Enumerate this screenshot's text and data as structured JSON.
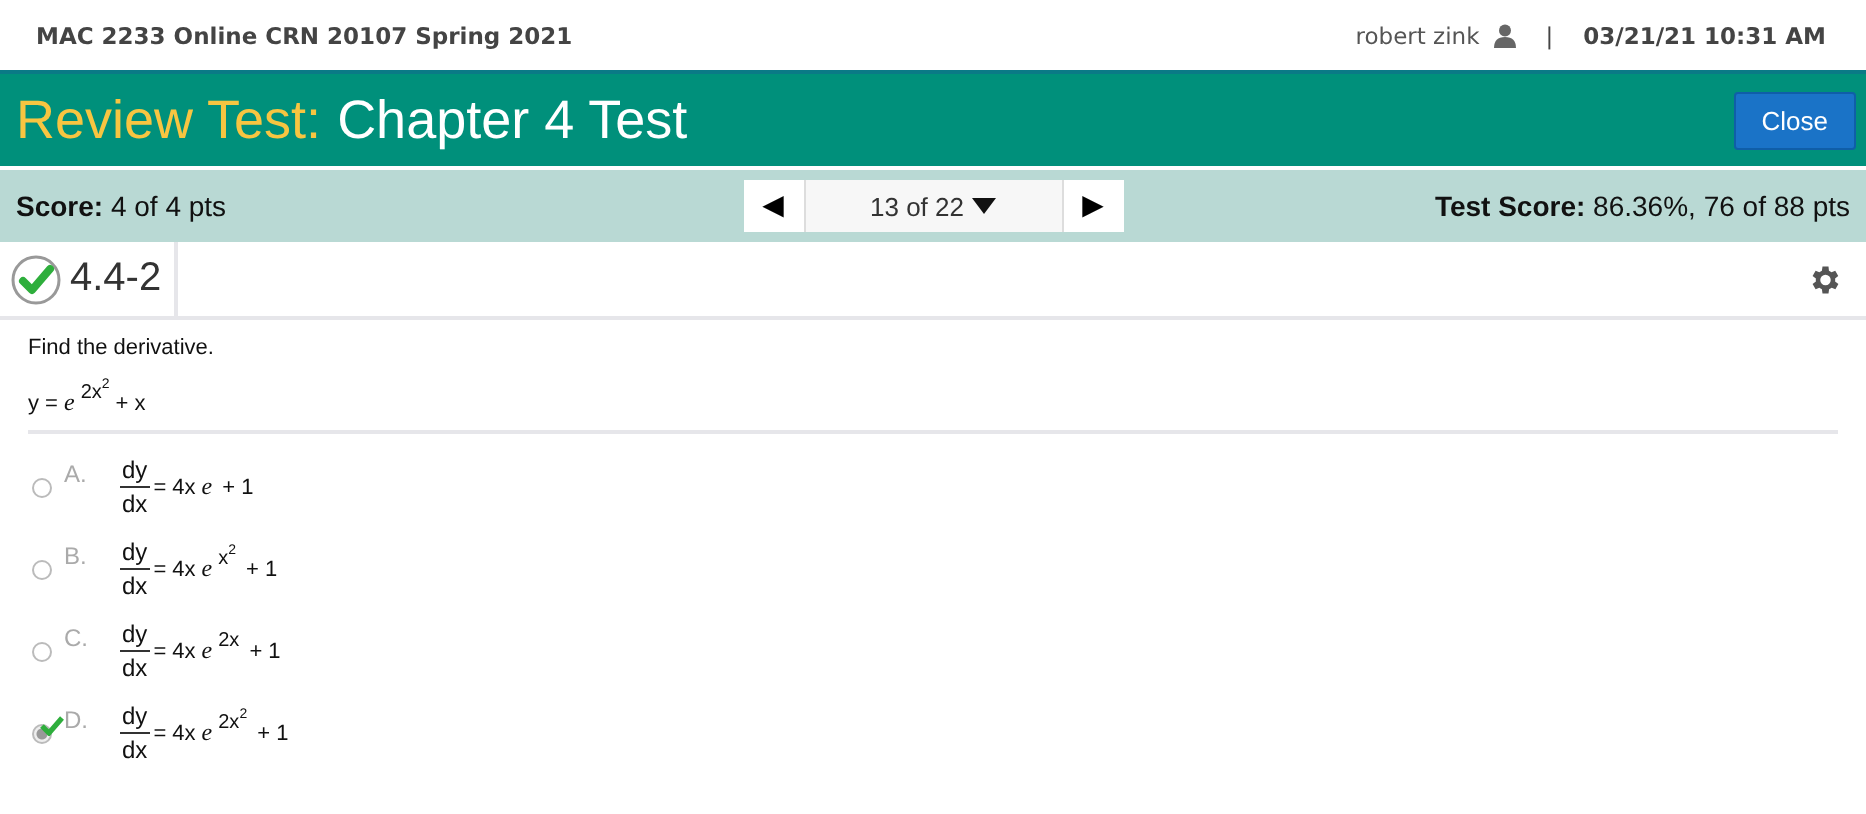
{
  "top_bar": {
    "course": "MAC 2233 Online CRN 20107 Spring 2021",
    "user": "robert zink",
    "separator": "|",
    "datetime": "03/21/21 10:31 AM"
  },
  "header": {
    "prefix": "Review Test:",
    "title": "Chapter 4 Test",
    "close_button": "Close"
  },
  "score_bar": {
    "score_label": "Score:",
    "score_value": "4 of 4 pts",
    "prev": "◀",
    "position": "13 of 22",
    "next": "▶",
    "test_score_label": "Test Score:",
    "test_score_value": "86.36%, 76 of 88 pts"
  },
  "question": {
    "id": "4.4-2",
    "correct": true,
    "prompt": "Find the derivative.",
    "equation": {
      "lhs": "y =",
      "base": "e",
      "exponent": "2x",
      "exponent_power": "2",
      "tail": "+ x"
    },
    "options": [
      {
        "letter": "A.",
        "numerator": "dy",
        "denominator": "dx",
        "coefficient": "= 4x",
        "base": "e",
        "tail": "+ 1",
        "selected": false
      },
      {
        "letter": "B.",
        "numerator": "dy",
        "denominator": "dx",
        "coefficient": "= 4x",
        "base": "e",
        "exponent": "x",
        "exponent_power": "2",
        "tail": "+ 1",
        "selected": false
      },
      {
        "letter": "C.",
        "numerator": "dy",
        "denominator": "dx",
        "coefficient": "= 4x",
        "base": "e",
        "exponent": "2x",
        "tail": "+ 1",
        "selected": false
      },
      {
        "letter": "D.",
        "numerator": "dy",
        "denominator": "dx",
        "coefficient": "= 4x",
        "base": "e",
        "exponent": "2x",
        "exponent_power": "2",
        "tail": "+ 1",
        "selected": true
      }
    ]
  }
}
